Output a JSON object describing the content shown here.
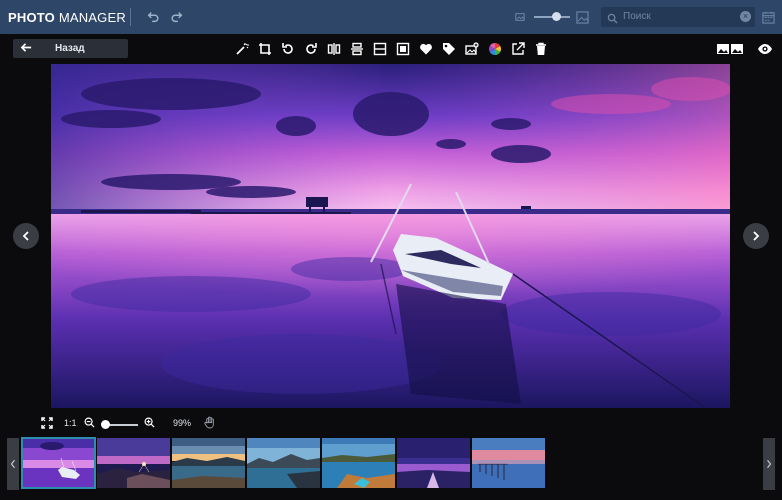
{
  "header": {
    "brand_bold": "PHOTO",
    "brand_thin": "MANAGER",
    "search_placeholder": "Поиск"
  },
  "toolbar": {
    "back_label": "Назад",
    "tools": [
      "magic-wand-icon",
      "crop-icon",
      "rotate-left-icon",
      "rotate-right-icon",
      "flip-horizontal-icon",
      "flip-vertical-icon",
      "fit-icon",
      "resize-icon",
      "favorite-icon",
      "tag-icon",
      "add-photo-icon",
      "color-icon",
      "share-icon",
      "delete-icon"
    ]
  },
  "viewer": {
    "zoom_fit_label": "1:1",
    "zoom_percent": "99%"
  },
  "filmstrip": {
    "count": 7,
    "selected_index": 0
  }
}
